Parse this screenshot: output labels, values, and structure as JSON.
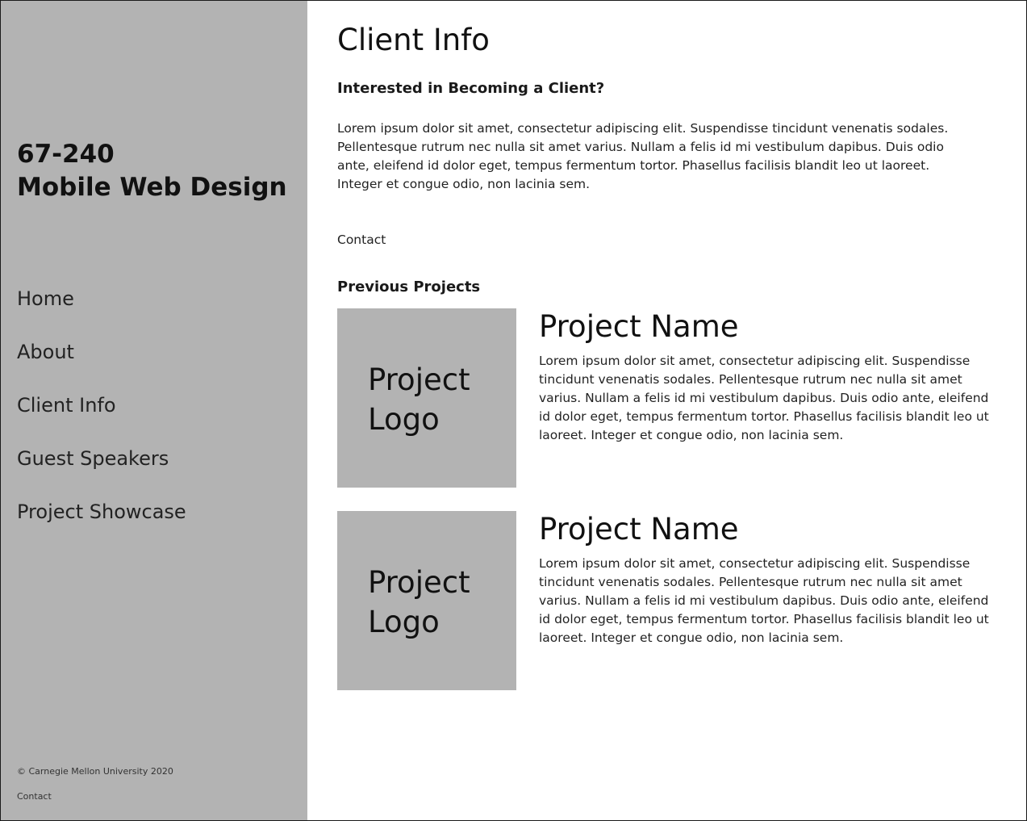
{
  "sidebar": {
    "course_number": "67-240",
    "course_name": "Mobile Web Design",
    "nav": [
      {
        "label": "Home"
      },
      {
        "label": "About"
      },
      {
        "label": "Client Info"
      },
      {
        "label": "Guest Speakers"
      },
      {
        "label": "Project Showcase"
      }
    ],
    "footer": {
      "copyright": "© Carnegie Mellon University 2020",
      "contact": "Contact"
    }
  },
  "main": {
    "title": "Client Info",
    "subheading": "Interested in Becoming a Client?",
    "intro": "Lorem ipsum dolor sit amet, consectetur adipiscing elit. Suspendisse tincidunt venenatis sodales. Pellentesque rutrum nec nulla sit amet varius. Nullam a felis id mi vestibulum dapibus. Duis odio ante, eleifend id dolor eget, tempus fermentum tortor. Phasellus facilisis blandit leo ut laoreet. Integer et congue odio, non lacinia sem.",
    "contact": "Contact",
    "previous_projects_heading": "Previous Projects",
    "projects": [
      {
        "logo_line1": "Project",
        "logo_line2": "Logo",
        "name": "Project Name",
        "description": "Lorem ipsum dolor sit amet, consectetur adipiscing elit. Suspendisse tincidunt venenatis sodales. Pellentesque rutrum nec nulla sit amet varius. Nullam a felis id mi vestibulum dapibus. Duis odio ante, eleifend id dolor eget, tempus fermentum tortor. Phasellus facilisis blandit leo ut laoreet. Integer et congue odio, non lacinia sem."
      },
      {
        "logo_line1": "Project",
        "logo_line2": "Logo",
        "name": "Project Name",
        "description": "Lorem ipsum dolor sit amet, consectetur adipiscing elit. Suspendisse tincidunt venenatis sodales. Pellentesque rutrum nec nulla sit amet varius. Nullam a felis id mi vestibulum dapibus. Duis odio ante, eleifend id dolor eget, tempus fermentum tortor. Phasellus facilisis blandit leo ut laoreet. Integer et congue odio, non lacinia sem."
      }
    ]
  },
  "colors": {
    "sidebar_bg": "#b3b3b3",
    "logo_bg": "#b3b3b3",
    "text": "#111111",
    "page_bg": "#ffffff"
  }
}
